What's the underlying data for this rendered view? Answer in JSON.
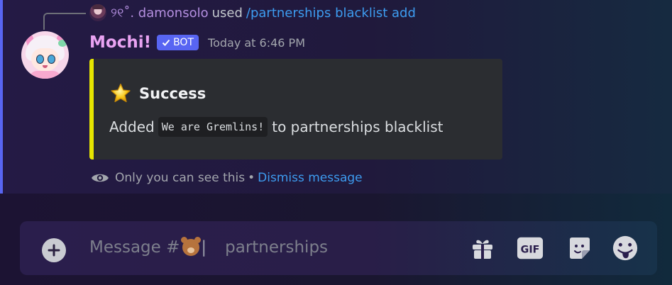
{
  "reply": {
    "username": "୨୧˚. damonsolo",
    "used_text": "used",
    "command": "/partnerships blacklist add"
  },
  "message": {
    "username": "Mochi!",
    "bot_tag": "BOT",
    "timestamp": "Today at 6:46 PM",
    "embed": {
      "accent_color": "#e6e600",
      "title_icon": "star-icon",
      "title": "Success",
      "desc_before": "Added",
      "desc_code": "We are Gremlins!",
      "desc_after": "to partnerships blacklist"
    },
    "ephemeral_note": "Only you can see this",
    "separator": "•",
    "dismiss_label": "Dismiss message"
  },
  "composer": {
    "placeholder_prefix": "Message #",
    "placeholder_channel": "partnerships",
    "icons": [
      "add-attachment-icon",
      "gift-icon",
      "gif-icon",
      "sticker-icon",
      "emoji-icon"
    ]
  },
  "colors": {
    "accent_blurple": "#5865f2",
    "link_blue": "#3d9cf0",
    "bot_name": "#e9a3f2",
    "reply_user": "#b48fe0"
  }
}
